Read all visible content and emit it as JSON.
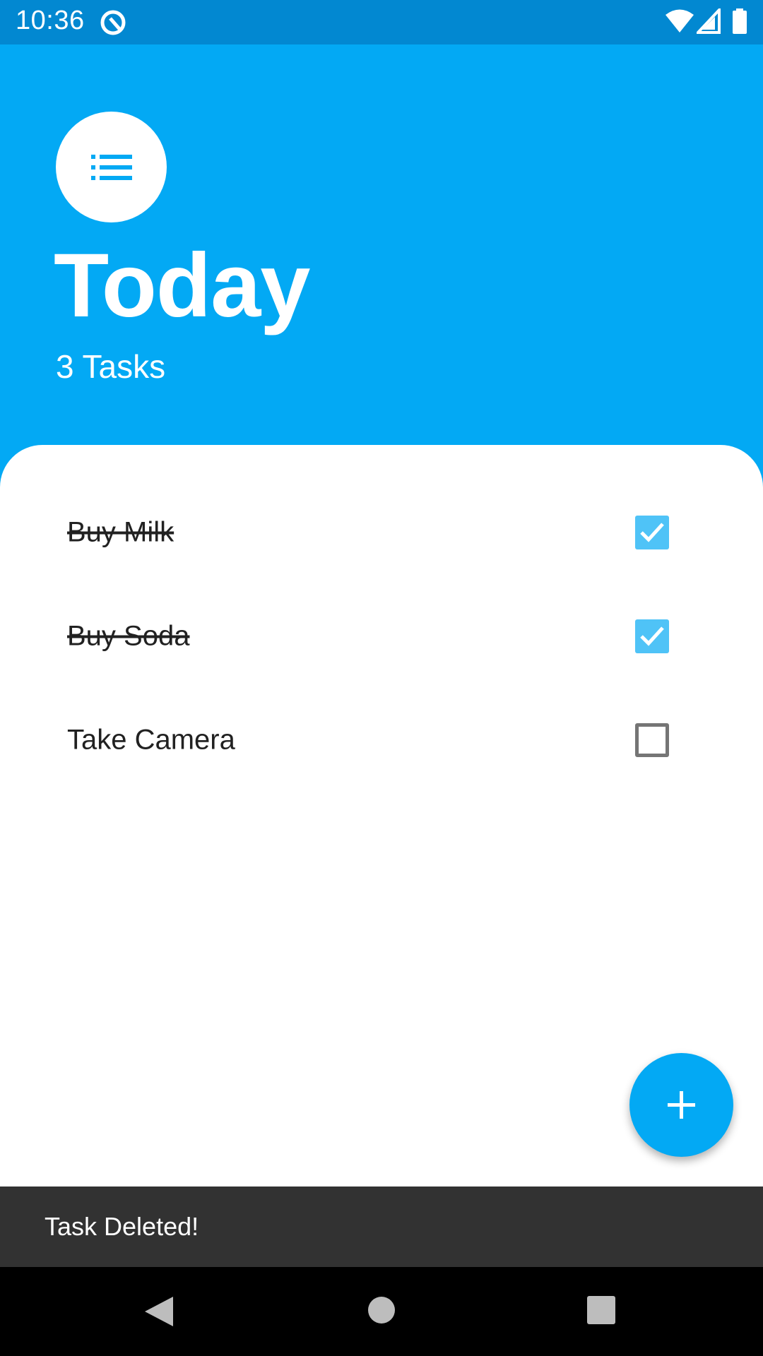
{
  "status_bar": {
    "time": "10:36",
    "icons": [
      "app-notification-icon",
      "wifi-icon",
      "cell-signal-icon",
      "battery-icon"
    ]
  },
  "header": {
    "icon": "list-icon",
    "title": "Today",
    "subtitle": "3 Tasks"
  },
  "tasks": [
    {
      "label": "Buy Milk",
      "done": true
    },
    {
      "label": "Buy Soda",
      "done": true
    },
    {
      "label": "Take Camera",
      "done": false
    }
  ],
  "fab": {
    "icon": "plus-icon"
  },
  "snackbar": {
    "message": "Task Deleted!"
  },
  "nav_bar": {
    "buttons": [
      "back-icon",
      "home-icon",
      "recents-icon"
    ]
  },
  "colors": {
    "primary": "#03a9f4",
    "primary_dark": "#0288d1",
    "checkbox_checked": "#4fc3f7",
    "snackbar_bg": "#323232"
  }
}
